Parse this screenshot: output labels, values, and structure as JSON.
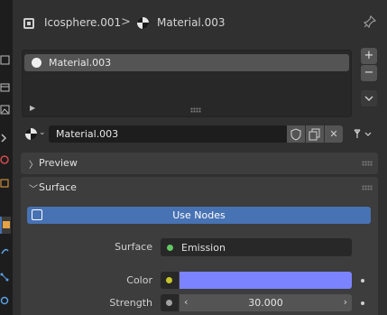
{
  "header": {
    "object_name": "Icosphere.001",
    "separator": ">",
    "material_name": "Material.003"
  },
  "slots": {
    "items": [
      {
        "label": "Material.003",
        "selected": true
      }
    ],
    "add_label": "+",
    "remove_label": "−",
    "menu_label": "⌄"
  },
  "material_selector": {
    "name": "Material.003",
    "fake_user_icon": "shield-icon",
    "duplicate_icon": "copy-icon",
    "unlink_label": "✕",
    "link_icon": "link-dropdown-icon"
  },
  "panels": {
    "preview": {
      "title": "Preview",
      "expanded": false
    },
    "surface": {
      "title": "Surface",
      "expanded": true
    }
  },
  "surface": {
    "use_nodes_label": "Use Nodes",
    "surface_label": "Surface",
    "surface_value": "Emission",
    "color_label": "Color",
    "color_value": "#7b83ff",
    "strength_label": "Strength",
    "strength_value": "30.000"
  },
  "colors": {
    "accent": "#4772b3",
    "socket_green": "#63c763",
    "socket_yellow": "#c7c729"
  }
}
